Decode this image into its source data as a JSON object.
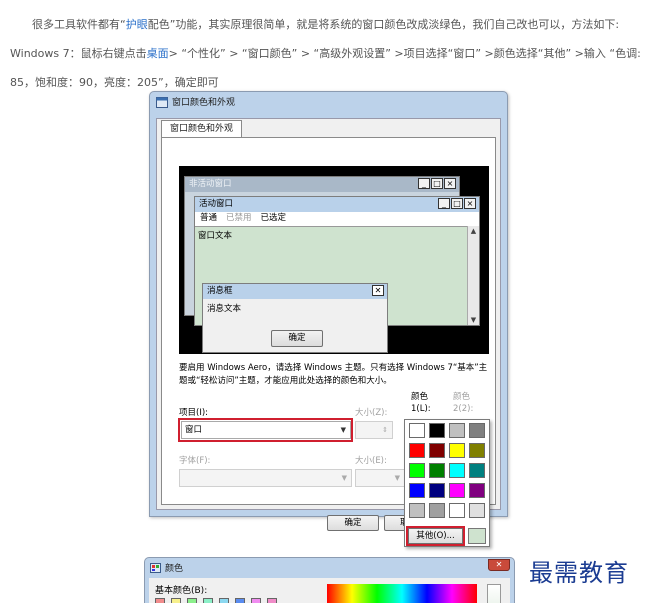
{
  "article": {
    "para1_a": "很多工具软件都有“",
    "para1_link": "护眼",
    "para1_b": "配色”功能，其实原理很简单，就是将系统的窗口颜色改成淡绿色，我们自己改也可以，方法如下:",
    "para2_a": "Windows 7：鼠标右键点击",
    "para2_link": "桌面",
    "para2_b": "> “个性化” > “窗口颜色” > “高级外观设置” >项目选择“窗口” >颜色选择“其他” >输入 “色调:",
    "para3": "85，饱和度：90，亮度：205”，确定即可"
  },
  "dialog": {
    "title": "窗口颜色和外观",
    "tab": "窗口颜色和外观",
    "preview": {
      "inactive_title": "非活动窗口",
      "active_title": "活动窗口",
      "menu_normal": "普通",
      "menu_disabled": "已禁用",
      "menu_selected": "已选定",
      "window_text": "窗口文本",
      "msgbox_title": "消息框",
      "msgbox_text": "消息文本",
      "ok": "确定"
    },
    "hint": "要启用 Windows Aero，请选择 Windows 主题。只有选择 Windows 7“基本”主题或“轻松访问”主题，才能应用此处选择的颜色和大小。",
    "item_label": "项目(I):",
    "item_value": "窗口",
    "size_label": "大小(Z):",
    "color1_label_a": "颜色",
    "color1_label_b": "1(L):",
    "color2_label_a": "颜色",
    "color2_label_b": "2(2):",
    "font_label": "字体(F):",
    "font_size_label": "大小(E):",
    "ok_button": "确定",
    "cancel_button_partial": "取"
  },
  "palette": {
    "colors": [
      "#ffffff",
      "#000000",
      "#c0c0c0",
      "#808080",
      "#ff0000",
      "#800000",
      "#ffff00",
      "#808000",
      "#00ff00",
      "#008000",
      "#00ffff",
      "#008080",
      "#0000ff",
      "#000080",
      "#ff00ff",
      "#800080",
      "#c0c0c0",
      "#a0a0a0",
      "#ffffff",
      "#e0e0e0"
    ],
    "other_button": "其他(O)...",
    "current_color": "#cfe3cf"
  },
  "dialog2": {
    "title": "颜色",
    "basic_colors_label": "基本颜色(B):",
    "mini_colors": [
      "#f28c8c",
      "#f7f08c",
      "#8cf08c",
      "#8cf0c8",
      "#8cd8f0",
      "#5a8cf0",
      "#f08cf0",
      "#f08cc8"
    ]
  },
  "watermark": "最需教育",
  "icons": {
    "window": "window-icon",
    "close": "close-icon"
  },
  "accent_red": "#d01f2f",
  "link_color": "#2a6fc9"
}
